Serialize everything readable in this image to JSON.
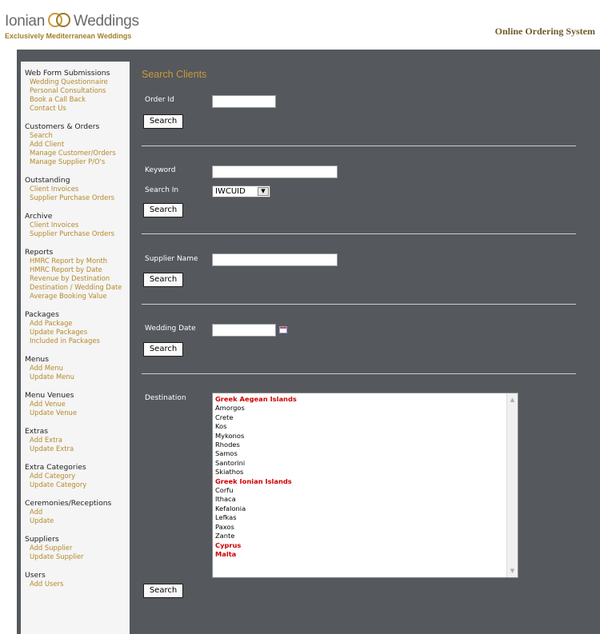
{
  "header": {
    "logo_left": "Ionian",
    "logo_right": "Weddings",
    "tagline": "Exclusively Mediterranean Weddings",
    "system_title": "Online Ordering System"
  },
  "sidebar": {
    "sections": [
      {
        "title": "Web Form Submissions",
        "items": [
          "Wedding Questionnaire",
          "Personal Consultations",
          "Book a Call Back",
          "Contact Us"
        ]
      },
      {
        "title": "Customers & Orders",
        "items": [
          "Search",
          "Add Client",
          "Manage Customer/Orders",
          "Manage Supplier P/O's"
        ]
      },
      {
        "title": "Outstanding",
        "items": [
          "Client Invoices",
          "Supplier Purchase Orders"
        ]
      },
      {
        "title": "Archive",
        "items": [
          "Client Invoices",
          "Supplier Purchase Orders"
        ]
      },
      {
        "title": "Reports",
        "items": [
          "HMRC Report by Month",
          "HMRC Report by Date",
          "Revenue by Destination",
          "Destination / Wedding Date",
          "Average Booking Value"
        ]
      },
      {
        "title": "Packages",
        "items": [
          "Add Package",
          "Update Packages",
          "Included in Packages"
        ]
      },
      {
        "title": "Menus",
        "items": [
          "Add Menu",
          "Update Menu"
        ]
      },
      {
        "title": "Menu Venues",
        "items": [
          "Add Venue",
          "Update Venue"
        ]
      },
      {
        "title": "Extras",
        "items": [
          "Add Extra",
          "Update Extra"
        ]
      },
      {
        "title": "Extra Categories",
        "items": [
          "Add Category",
          "Update Category"
        ]
      },
      {
        "title": "Ceremonies/Receptions",
        "items": [
          "Add",
          "Update"
        ]
      },
      {
        "title": "Suppliers",
        "items": [
          "Add Supplier",
          "Update Supplier"
        ]
      },
      {
        "title": "Users",
        "items": [
          "Add Users"
        ]
      }
    ]
  },
  "main": {
    "title": "Search Clients",
    "order_id_label": "Order Id",
    "order_id_value": "",
    "keyword_label": "Keyword",
    "keyword_value": "",
    "search_in_label": "Search In",
    "search_in_value": "IWCUID",
    "supplier_name_label": "Supplier Name",
    "supplier_name_value": "",
    "wedding_date_label": "Wedding Date",
    "wedding_date_value": "",
    "destination_label": "Destination",
    "search_button": "Search",
    "destinations": [
      {
        "label": "Greek Aegean Islands",
        "group": true
      },
      {
        "label": "Amorgos",
        "group": false
      },
      {
        "label": "Crete",
        "group": false
      },
      {
        "label": "Kos",
        "group": false
      },
      {
        "label": "Mykonos",
        "group": false
      },
      {
        "label": "Rhodes",
        "group": false
      },
      {
        "label": "Samos",
        "group": false
      },
      {
        "label": "Santorini",
        "group": false
      },
      {
        "label": "Skiathos",
        "group": false
      },
      {
        "label": "Greek Ionian Islands",
        "group": true
      },
      {
        "label": "Corfu",
        "group": false
      },
      {
        "label": "Ithaca",
        "group": false
      },
      {
        "label": "Kefalonia",
        "group": false
      },
      {
        "label": "Lefkas",
        "group": false
      },
      {
        "label": "Paxos",
        "group": false
      },
      {
        "label": "Zante",
        "group": false
      },
      {
        "label": "Cyprus",
        "group": true
      },
      {
        "label": "Malta",
        "group": true
      }
    ]
  }
}
